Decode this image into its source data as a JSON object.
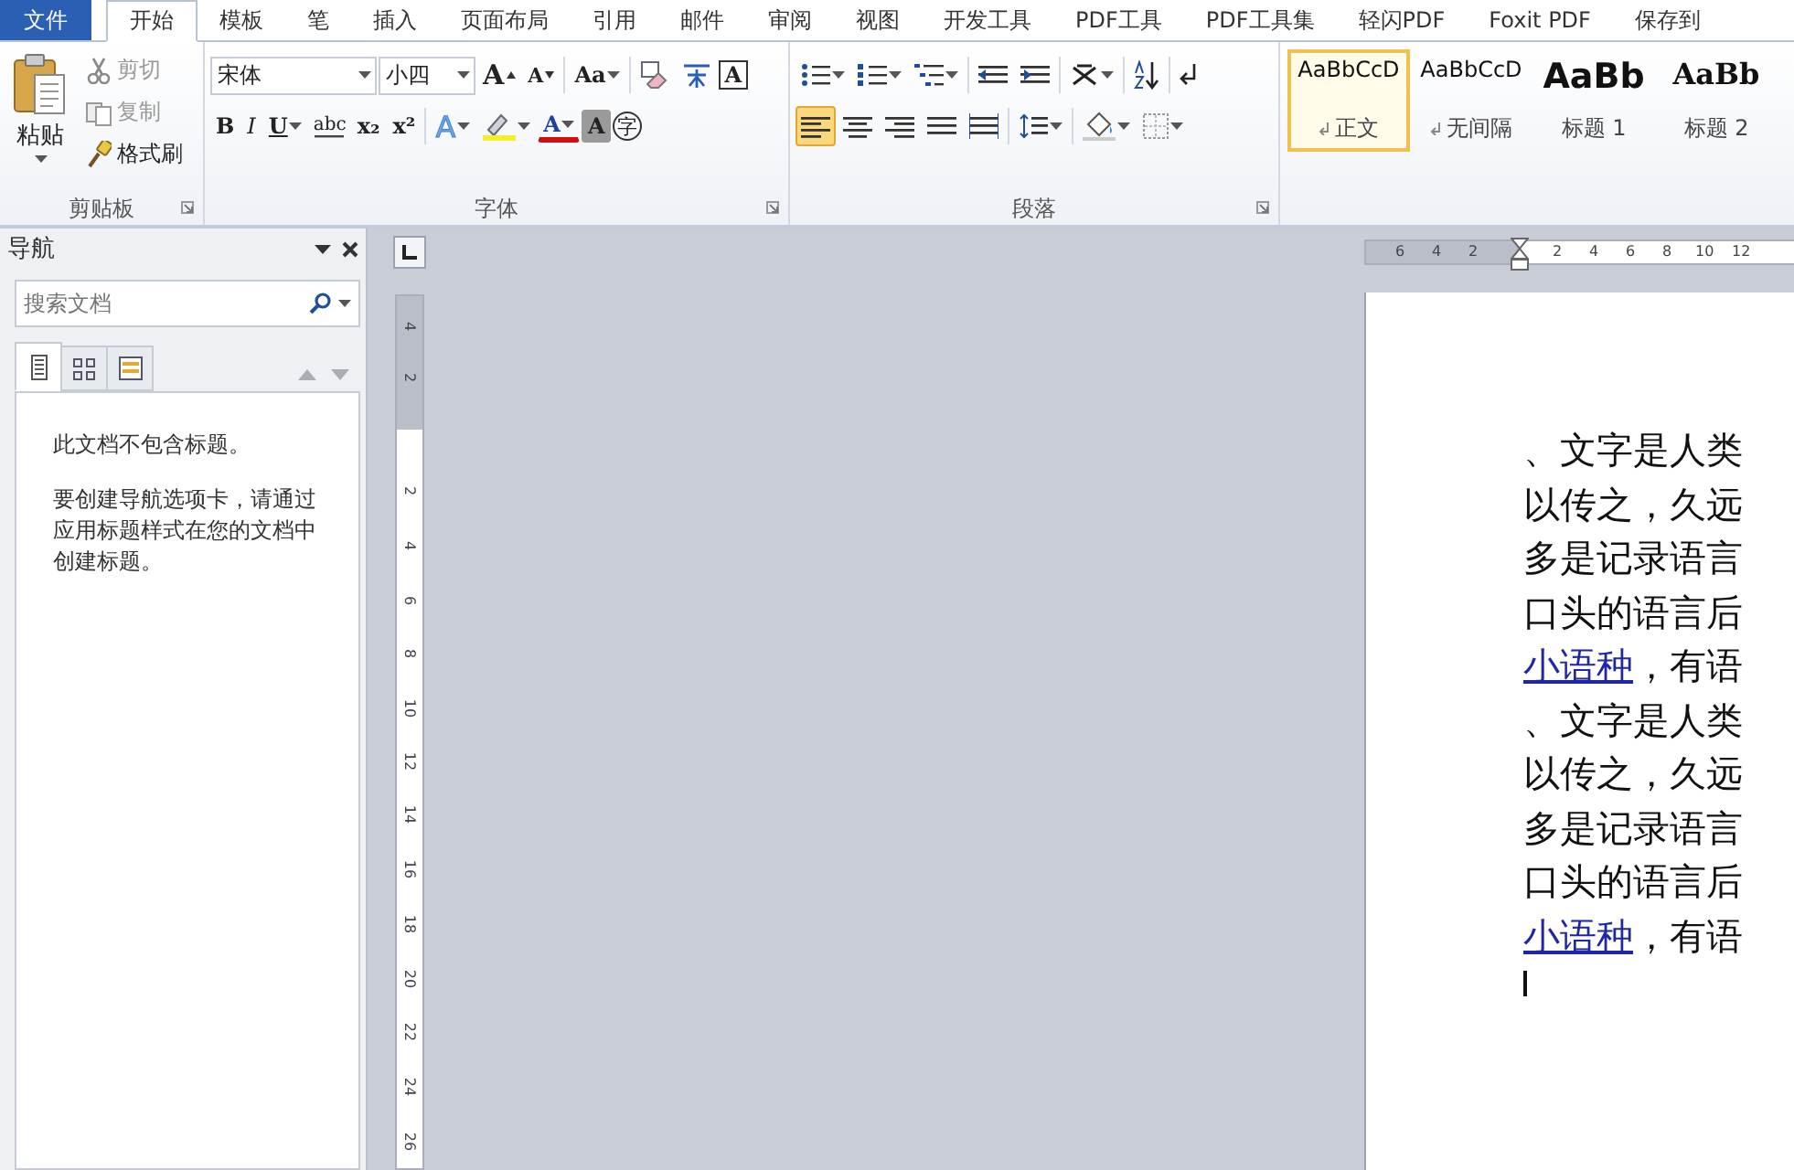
{
  "menu_tabs": [
    {
      "label": "文件",
      "kind": "file",
      "selected": false
    },
    {
      "label": "开始",
      "kind": "tab",
      "selected": true
    },
    {
      "label": "模板",
      "kind": "tab",
      "selected": false
    },
    {
      "label": "笔",
      "kind": "tab",
      "selected": false
    },
    {
      "label": "插入",
      "kind": "tab",
      "selected": false
    },
    {
      "label": "页面布局",
      "kind": "tab",
      "selected": false
    },
    {
      "label": "引用",
      "kind": "tab",
      "selected": false
    },
    {
      "label": "邮件",
      "kind": "tab",
      "selected": false
    },
    {
      "label": "审阅",
      "kind": "tab",
      "selected": false
    },
    {
      "label": "视图",
      "kind": "tab",
      "selected": false
    },
    {
      "label": "开发工具",
      "kind": "tab",
      "selected": false
    },
    {
      "label": "PDF工具",
      "kind": "tab",
      "selected": false
    },
    {
      "label": "PDF工具集",
      "kind": "tab",
      "selected": false
    },
    {
      "label": "轻闪PDF",
      "kind": "tab",
      "selected": false
    },
    {
      "label": "Foxit PDF",
      "kind": "tab",
      "selected": false
    },
    {
      "label": "保存到",
      "kind": "tab",
      "selected": false
    }
  ],
  "clipboard": {
    "label": "剪贴板",
    "paste": "粘贴",
    "items": [
      {
        "label": "剪切",
        "kind": "cut",
        "disabled": true
      },
      {
        "label": "复制",
        "kind": "copy",
        "disabled": true
      },
      {
        "label": "格式刷",
        "kind": "painter",
        "disabled": false
      }
    ]
  },
  "font": {
    "label": "字体",
    "font_name": "宋体",
    "font_size": "小四",
    "row1": [
      {
        "kind": "grow",
        "glyph": "A"
      },
      {
        "kind": "shrink",
        "glyph": "A"
      },
      {
        "kind": "case",
        "glyph": "Aa",
        "dropdown": true
      },
      {
        "kind": "clear"
      },
      {
        "kind": "phonetic"
      },
      {
        "kind": "boxed",
        "glyph": "A"
      }
    ],
    "row2": [
      {
        "kind": "bold",
        "glyph": "B"
      },
      {
        "kind": "italic",
        "glyph": "I"
      },
      {
        "kind": "underline",
        "glyph": "U",
        "dropdown": true
      },
      {
        "kind": "strike",
        "glyph": "abc"
      },
      {
        "kind": "sub",
        "glyph": "x₂"
      },
      {
        "kind": "sup",
        "glyph": "x²"
      },
      {
        "kind": "effect",
        "glyph": "A",
        "dropdown": true
      },
      {
        "kind": "highlight",
        "dropdown": true
      },
      {
        "kind": "color",
        "glyph": "A",
        "dropdown": true
      },
      {
        "kind": "shade",
        "glyph": "A"
      },
      {
        "kind": "enclose",
        "glyph": "字"
      }
    ]
  },
  "paragraph": {
    "label": "段落",
    "row1": [
      {
        "kind": "bullets",
        "dropdown": true
      },
      {
        "kind": "numbering",
        "dropdown": true
      },
      {
        "kind": "multilevel",
        "dropdown": true
      },
      {
        "kind": "outdent"
      },
      {
        "kind": "indent"
      },
      {
        "kind": "asian",
        "dropdown": true
      },
      {
        "kind": "sort"
      },
      {
        "kind": "marks"
      }
    ],
    "row2": [
      {
        "kind": "align-left",
        "selected": true
      },
      {
        "kind": "align-center",
        "selected": false
      },
      {
        "kind": "align-right",
        "selected": false
      },
      {
        "kind": "justify",
        "selected": false
      },
      {
        "kind": "distribute",
        "selected": false
      },
      {
        "kind": "spacing",
        "dropdown": true
      },
      {
        "kind": "fill",
        "dropdown": true
      },
      {
        "kind": "border",
        "dropdown": true
      }
    ]
  },
  "styles": [
    {
      "sample": "AaBbCcD",
      "name": "正文",
      "kind": "normal",
      "para_mark": true,
      "selected": true
    },
    {
      "sample": "AaBbCcD",
      "name": "无间隔",
      "kind": "normal",
      "para_mark": true,
      "selected": false
    },
    {
      "sample": "AaBb",
      "name": "标题 1",
      "kind": "h1",
      "para_mark": false,
      "selected": false
    },
    {
      "sample": "AaBb",
      "name": "标题 2",
      "kind": "h2",
      "para_mark": false,
      "selected": false
    }
  ],
  "nav": {
    "title": "导航",
    "placeholder": "搜索文档",
    "views": [
      {
        "kind": "headings",
        "selected": true
      },
      {
        "kind": "pages",
        "selected": false
      },
      {
        "kind": "results",
        "selected": false
      }
    ],
    "messages": [
      "此文档不包含标题。",
      "要创建导航选项卡，请通过应用标题样式在您的文档中创建标题。"
    ]
  },
  "horizontal_ruler": [
    "6",
    "4",
    "2",
    "2",
    "4",
    "6",
    "8",
    "10",
    "12"
  ],
  "vertical_ruler": [
    "4",
    "2",
    "2",
    "4",
    "6",
    "8",
    "10",
    "12",
    "14",
    "16",
    "18",
    "20",
    "22",
    "24",
    "26"
  ],
  "document": [
    {
      "text": "、文字是人类"
    },
    {
      "text": "以传之，久远"
    },
    {
      "text": "多是记录语言"
    },
    {
      "text": "口头的语言后"
    },
    {
      "link": "小语种",
      "text": "，有语"
    },
    {
      "text": "、文字是人类"
    },
    {
      "text": "以传之，久远"
    },
    {
      "text": "多是记录语言"
    },
    {
      "text": "口头的语言后"
    },
    {
      "link": "小语种",
      "text": "，有语"
    }
  ]
}
